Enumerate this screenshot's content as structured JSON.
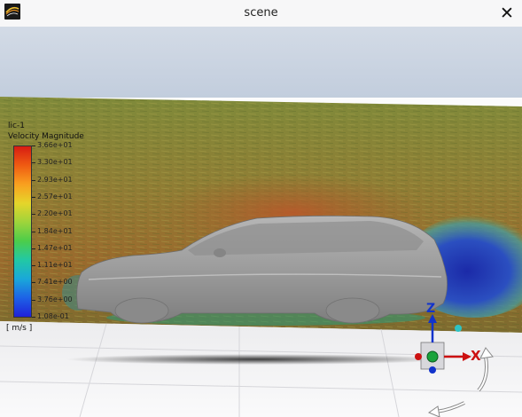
{
  "window": {
    "title": "scene",
    "app_icon": "fluent-app-icon",
    "close_glyph": "✕"
  },
  "legend": {
    "surface_name": "lic-1",
    "field": "Velocity Magnitude",
    "units": "[ m/s ]",
    "ticks": [
      "3.66e+01",
      "3.30e+01",
      "2.93e+01",
      "2.57e+01",
      "2.20e+01",
      "1.84e+01",
      "1.47e+01",
      "1.11e+01",
      "7.41e+00",
      "3.76e+00",
      "1.08e-01"
    ],
    "colors": [
      "#d71c12",
      "#ef5b12",
      "#f9a01f",
      "#e6d52a",
      "#9fd43b",
      "#4ccd4a",
      "#22c8a4",
      "#1aa8d9",
      "#1d62e6",
      "#2021d8"
    ]
  },
  "axes_triad": {
    "z_label": "Z",
    "x_label": "X",
    "x_color": "#cc1111",
    "z_color": "#1133cc",
    "center_color": "#1aa33c"
  },
  "scene": {
    "sky_color": "#c7d2e0",
    "ground_color": "#f4f4f5",
    "car_color": "#9a9a9a"
  }
}
